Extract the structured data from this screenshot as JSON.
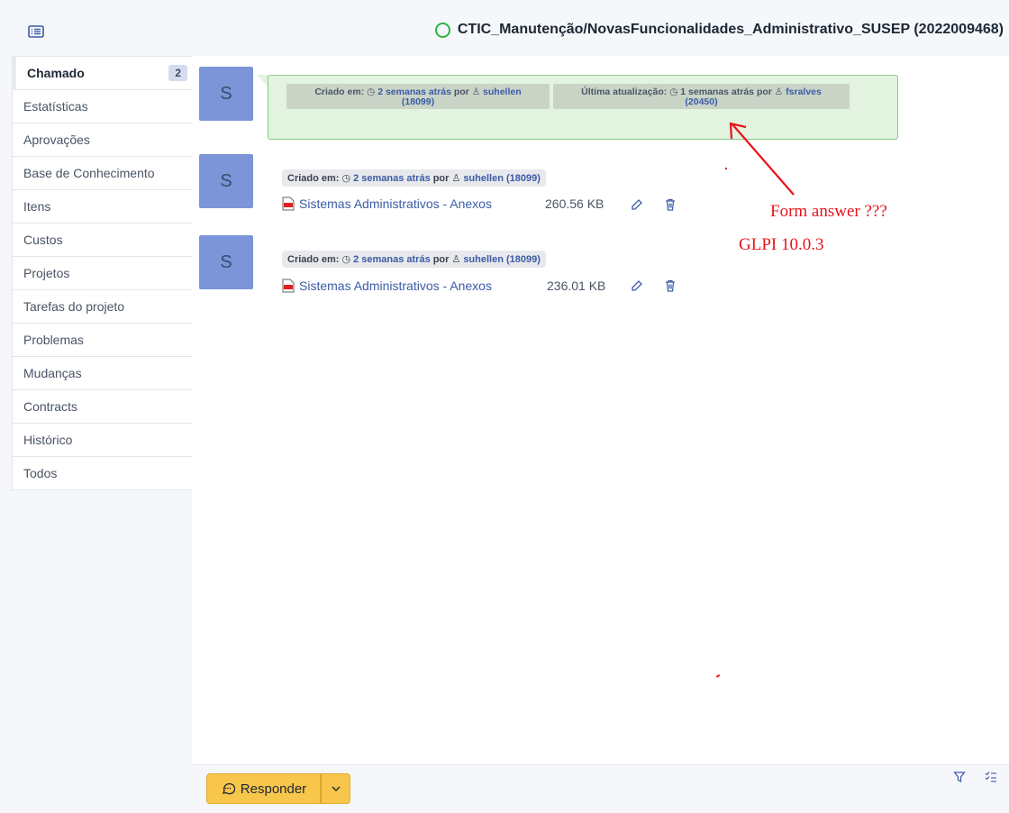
{
  "header": {
    "ticket_title": "CTIC_Manutenção/NovasFuncionalidades_Administrativo_SUSEP (2022009468)",
    "status_icon": "circle-outline-green"
  },
  "sidebar": {
    "items": [
      {
        "label": "Chamado",
        "badge": "2",
        "active": true
      },
      {
        "label": "Estatísticas"
      },
      {
        "label": "Aprovações"
      },
      {
        "label": "Base de Conhecimento"
      },
      {
        "label": "Itens"
      },
      {
        "label": "Custos"
      },
      {
        "label": "Projetos"
      },
      {
        "label": "Tarefas do projeto"
      },
      {
        "label": "Problemas"
      },
      {
        "label": "Mudanças"
      },
      {
        "label": "Contracts"
      },
      {
        "label": "Histórico"
      },
      {
        "label": "Todos"
      }
    ]
  },
  "timeline": {
    "main_item": {
      "avatar": "S",
      "created_label": "Criado em:",
      "created_when": "2 semanas atrás",
      "created_by_word": "por",
      "created_user": "suhellen",
      "created_user_id": "(18099)",
      "updated_label": "Última atualização:",
      "updated_when": "1 semanas atrás",
      "updated_by_word": "por",
      "updated_user": "fsralves",
      "updated_user_id": "(20450)"
    },
    "documents": [
      {
        "avatar": "S",
        "created_label": "Criado em:",
        "when": "2 semanas atrás",
        "by_word": "por",
        "user": "suhellen (18099)",
        "filename": "Sistemas Administrativos - Anexos",
        "size": "260.56 KB"
      },
      {
        "avatar": "S",
        "created_label": "Criado em:",
        "when": "2 semanas atrás",
        "by_word": "por",
        "user": "suhellen (18099)",
        "filename": "Sistemas Administrativos - Anexos",
        "size": "236.01 KB"
      }
    ]
  },
  "annotations": {
    "line1": "Form answer ???",
    "line2": "GLPI 10.0.3",
    "color": "#e8141a"
  },
  "footer": {
    "reply_label": "Responder"
  },
  "colors": {
    "avatar": "#7b95d8",
    "bubble": "#e2f3df",
    "reply_button": "#f7c64b",
    "link": "#3b5ba5"
  }
}
